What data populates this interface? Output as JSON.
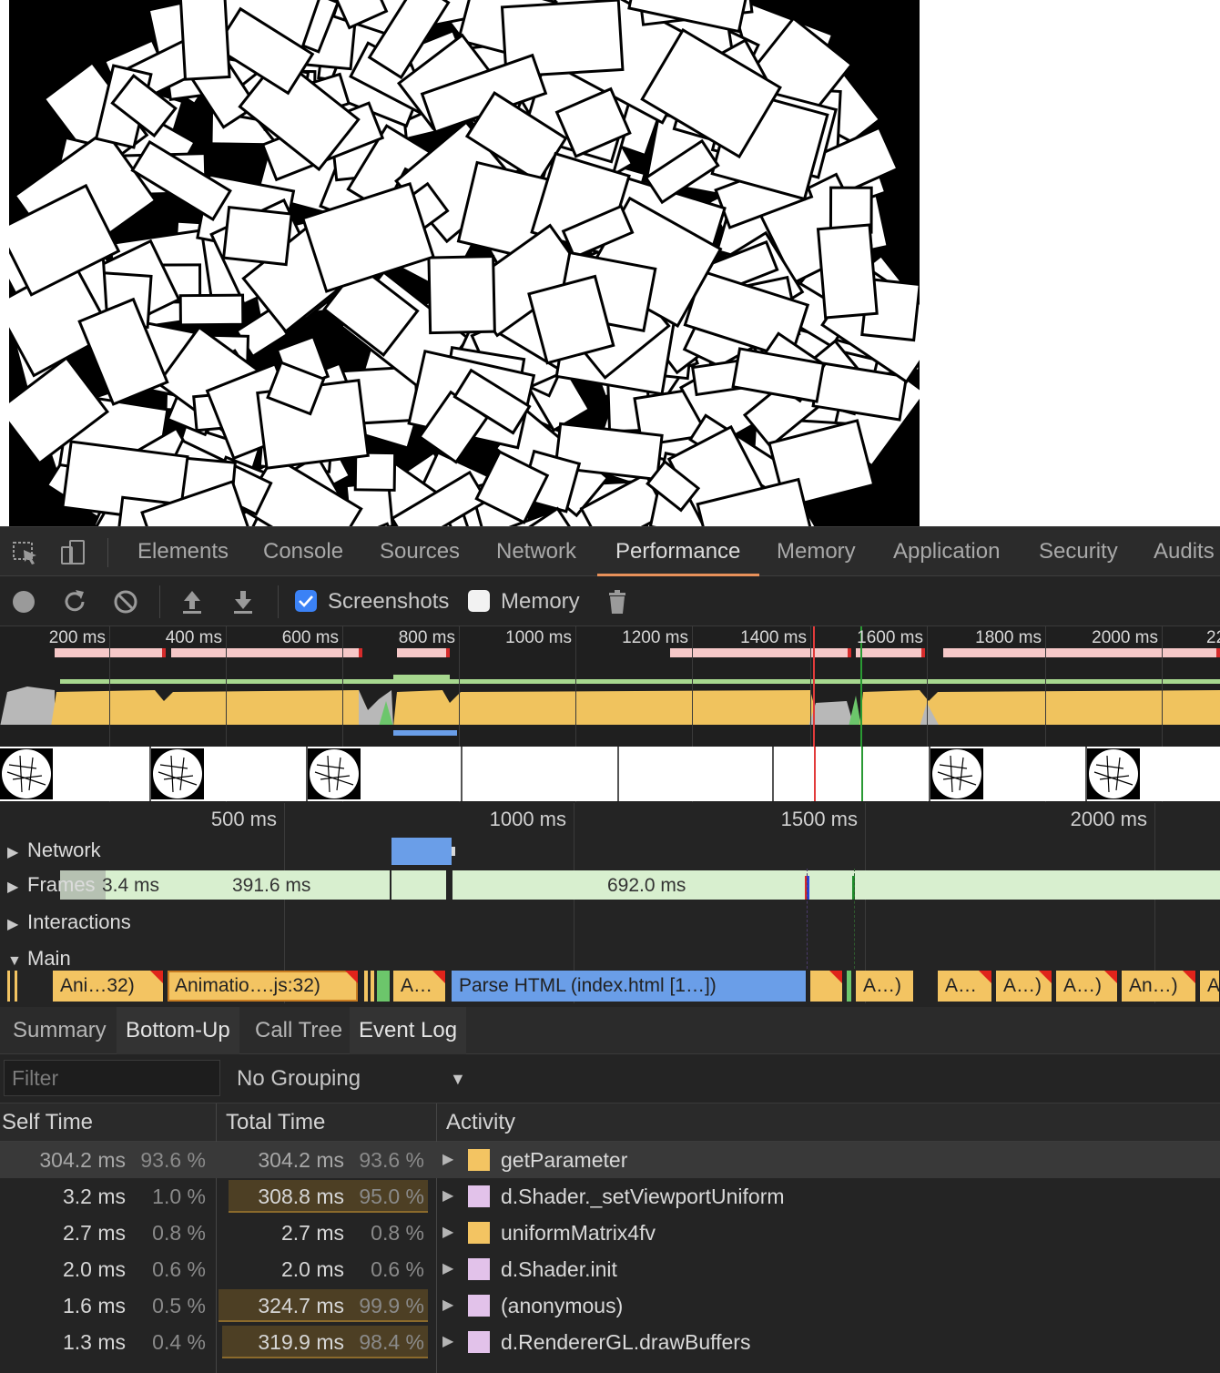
{
  "devtools": {
    "tabs": [
      "Elements",
      "Console",
      "Sources",
      "Network",
      "Performance",
      "Memory",
      "Application",
      "Security",
      "Audits"
    ],
    "active_tab": "Performance"
  },
  "toolbar": {
    "screenshots_label": "Screenshots",
    "screenshots_checked": true,
    "memory_label": "Memory",
    "memory_checked": false
  },
  "overview": {
    "ticks": [
      "200 ms",
      "400 ms",
      "600 ms",
      "800 ms",
      "1000 ms",
      "1200 ms",
      "1400 ms",
      "1600 ms",
      "1800 ms",
      "2000 ms",
      "22"
    ]
  },
  "timeline": {
    "ticks": [
      "500 ms",
      "1000 ms",
      "1500 ms",
      "2000 ms"
    ],
    "tracks": {
      "network": "Network",
      "frames": "Frames",
      "interactions": "Interactions",
      "main": "Main"
    },
    "frames": {
      "first": "3.4 ms",
      "second": "391.6 ms",
      "third": "692.0 ms"
    },
    "main_blocks": [
      "Ani…32)",
      "Animatio….js:32)",
      "A…",
      "Parse HTML (index.html [1…])",
      "A…)",
      "A…",
      "A…)",
      "A…)",
      "An…)",
      "A"
    ]
  },
  "bottom": {
    "tabs": [
      "Summary",
      "Bottom-Up",
      "Call Tree",
      "Event Log"
    ],
    "active_tab": "Bottom-Up",
    "filter_placeholder": "Filter",
    "grouping": "No Grouping",
    "columns": {
      "self": "Self Time",
      "total": "Total Time",
      "activity": "Activity"
    },
    "rows": [
      {
        "self_ms": "304.2 ms",
        "self_pct": "93.6 %",
        "total_ms": "304.2 ms",
        "total_pct": "93.6 %",
        "activity": "getParameter",
        "color": "#f3c462",
        "total_fraction": 0.936
      },
      {
        "self_ms": "3.2 ms",
        "self_pct": "1.0 %",
        "total_ms": "308.8 ms",
        "total_pct": "95.0 %",
        "activity": "d.Shader._setViewportUniform",
        "color": "#e2c2ea",
        "total_fraction": 0.95
      },
      {
        "self_ms": "2.7 ms",
        "self_pct": "0.8 %",
        "total_ms": "2.7 ms",
        "total_pct": "0.8 %",
        "activity": "uniformMatrix4fv",
        "color": "#f3c462",
        "total_fraction": 0.008
      },
      {
        "self_ms": "2.0 ms",
        "self_pct": "0.6 %",
        "total_ms": "2.0 ms",
        "total_pct": "0.6 %",
        "activity": "d.Shader.init",
        "color": "#e2c2ea",
        "total_fraction": 0.006
      },
      {
        "self_ms": "1.6 ms",
        "self_pct": "0.5 %",
        "total_ms": "324.7 ms",
        "total_pct": "99.9 %",
        "activity": "(anonymous)",
        "color": "#e2c2ea",
        "total_fraction": 0.999
      },
      {
        "self_ms": "1.3 ms",
        "self_pct": "0.4 %",
        "total_ms": "319.9 ms",
        "total_pct": "98.4 %",
        "activity": "d.RendererGL.drawBuffers",
        "color": "#e2c2ea",
        "total_fraction": 0.984
      }
    ]
  },
  "colors": {
    "scripting": "#f3c462",
    "loading": "#6a9ee8",
    "frame": "#d8efcf",
    "accent": "#e8915a",
    "checkbox": "#3b82f6"
  }
}
